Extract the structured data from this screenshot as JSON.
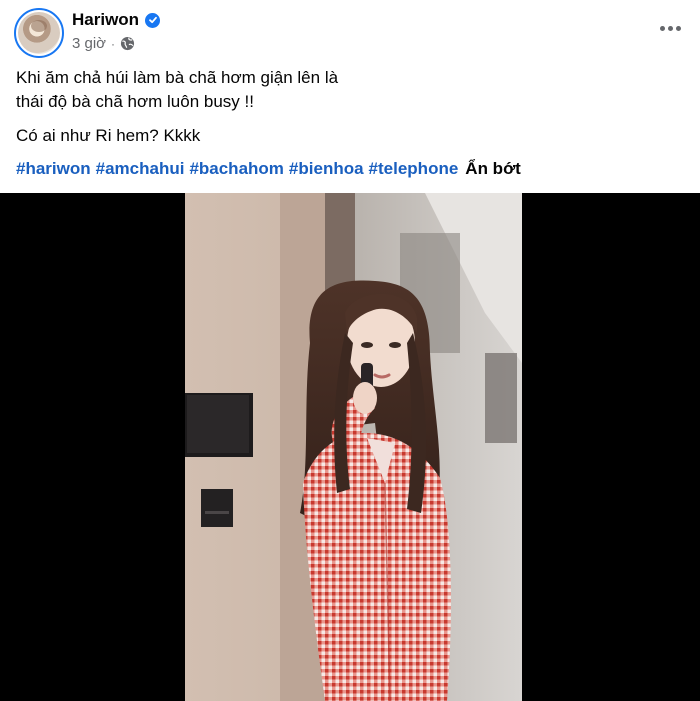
{
  "post": {
    "author": "Hariwon",
    "time": "3 giờ",
    "separator": "·",
    "line1": "Khi ăm chả húi làm bà chã hơm giận lên là",
    "line2": "thái độ bà chã hơm luôn busy !!",
    "line3": "Có ai như Ri hem? Kkkk",
    "hashtags": [
      "#hariwon",
      "#amchahui",
      "#bachahom",
      "#bienhoa",
      "#telephone"
    ],
    "see_less": "Ẩn bớt"
  },
  "icons": {
    "verified": "verified-badge-icon",
    "privacy": "globe-icon",
    "more": "more-options-icon"
  },
  "colors": {
    "accent": "#1877f2",
    "hashtag": "#1a5fbf",
    "secondary_text": "#65676b",
    "media_background": "#000000",
    "shirt_check": "#d9463a"
  }
}
